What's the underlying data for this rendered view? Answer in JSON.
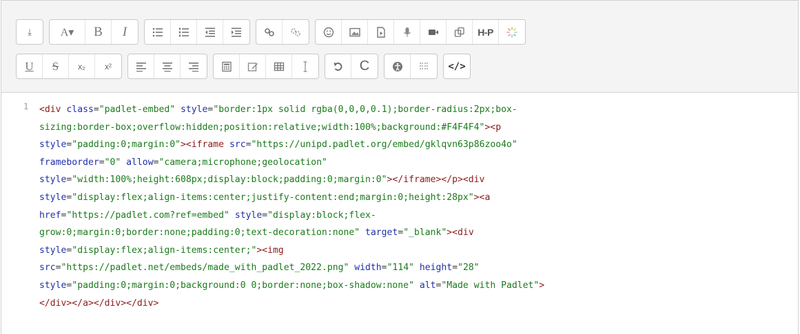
{
  "toolbar": {
    "row1": {
      "toggle": "⤓",
      "font_color": "A▾",
      "bold": "B",
      "italic": "I",
      "h5p": "H-P"
    },
    "row2": {
      "underline": "U",
      "strikethrough": "S",
      "subscript": "x₂",
      "superscript": "x²",
      "redo": "C",
      "html": "</>"
    }
  },
  "code": {
    "line_number": "1",
    "lines": [
      [
        [
          "t",
          "<div "
        ],
        [
          "a",
          "class"
        ],
        [
          "p",
          "="
        ],
        [
          "v",
          "\"padlet-embed\""
        ],
        [
          "p",
          " "
        ],
        [
          "a",
          "style"
        ],
        [
          "p",
          "="
        ],
        [
          "v",
          "\"border:1px solid rgba(0,0,0,0.1);border-radius:2px;box-"
        ]
      ],
      [
        [
          "v",
          "sizing:border-box;overflow:hidden;position:relative;width:100%;background:#F4F4F4\""
        ],
        [
          "t",
          "><p"
        ]
      ],
      [
        [
          "a",
          "style"
        ],
        [
          "p",
          "="
        ],
        [
          "v",
          "\"padding:0;margin:0\""
        ],
        [
          "t",
          "><iframe "
        ],
        [
          "a",
          "src"
        ],
        [
          "p",
          "="
        ],
        [
          "v",
          "\"https://unipd.padlet.org/embed/gklqvn63p86zoo4o\""
        ]
      ],
      [
        [
          "a",
          "frameborder"
        ],
        [
          "p",
          "="
        ],
        [
          "v",
          "\"0\""
        ],
        [
          "p",
          " "
        ],
        [
          "a",
          "allow"
        ],
        [
          "p",
          "="
        ],
        [
          "v",
          "\"camera;microphone;geolocation\""
        ]
      ],
      [
        [
          "a",
          "style"
        ],
        [
          "p",
          "="
        ],
        [
          "v",
          "\"width:100%;height:608px;display:block;padding:0;margin:0\""
        ],
        [
          "t",
          "></iframe></p><div"
        ]
      ],
      [
        [
          "a",
          "style"
        ],
        [
          "p",
          "="
        ],
        [
          "v",
          "\"display:flex;align-items:center;justify-content:end;margin:0;height:28px\""
        ],
        [
          "t",
          "><a"
        ]
      ],
      [
        [
          "a",
          "href"
        ],
        [
          "p",
          "="
        ],
        [
          "v",
          "\"https://padlet.com?ref=embed\""
        ],
        [
          "p",
          " "
        ],
        [
          "a",
          "style"
        ],
        [
          "p",
          "="
        ],
        [
          "v",
          "\"display:block;flex-"
        ]
      ],
      [
        [
          "v",
          "grow:0;margin:0;border:none;padding:0;text-decoration:none\""
        ],
        [
          "p",
          " "
        ],
        [
          "a",
          "target"
        ],
        [
          "p",
          "="
        ],
        [
          "v",
          "\"_blank\""
        ],
        [
          "t",
          "><div"
        ]
      ],
      [
        [
          "a",
          "style"
        ],
        [
          "p",
          "="
        ],
        [
          "v",
          "\"display:flex;align-items:center;\""
        ],
        [
          "t",
          "><img"
        ]
      ],
      [
        [
          "a",
          "src"
        ],
        [
          "p",
          "="
        ],
        [
          "v",
          "\"https://padlet.net/embeds/made_with_padlet_2022.png\""
        ],
        [
          "p",
          " "
        ],
        [
          "a",
          "width"
        ],
        [
          "p",
          "="
        ],
        [
          "v",
          "\"114\""
        ],
        [
          "p",
          " "
        ],
        [
          "a",
          "height"
        ],
        [
          "p",
          "="
        ],
        [
          "v",
          "\"28\""
        ]
      ],
      [
        [
          "a",
          "style"
        ],
        [
          "p",
          "="
        ],
        [
          "v",
          "\"padding:0;margin:0;background:0 0;border:none;box-shadow:none\""
        ],
        [
          "p",
          " "
        ],
        [
          "a",
          "alt"
        ],
        [
          "p",
          "="
        ],
        [
          "v",
          "\"Made with Padlet\""
        ],
        [
          "t",
          ">"
        ]
      ],
      [
        [
          "t",
          "</div></a></div></div>"
        ]
      ]
    ]
  },
  "colors": {
    "tag": "#8b1a1a",
    "attribute": "#1f2fa8",
    "value": "#1a7a1a",
    "toolbar_bg": "#f4f4f4"
  }
}
